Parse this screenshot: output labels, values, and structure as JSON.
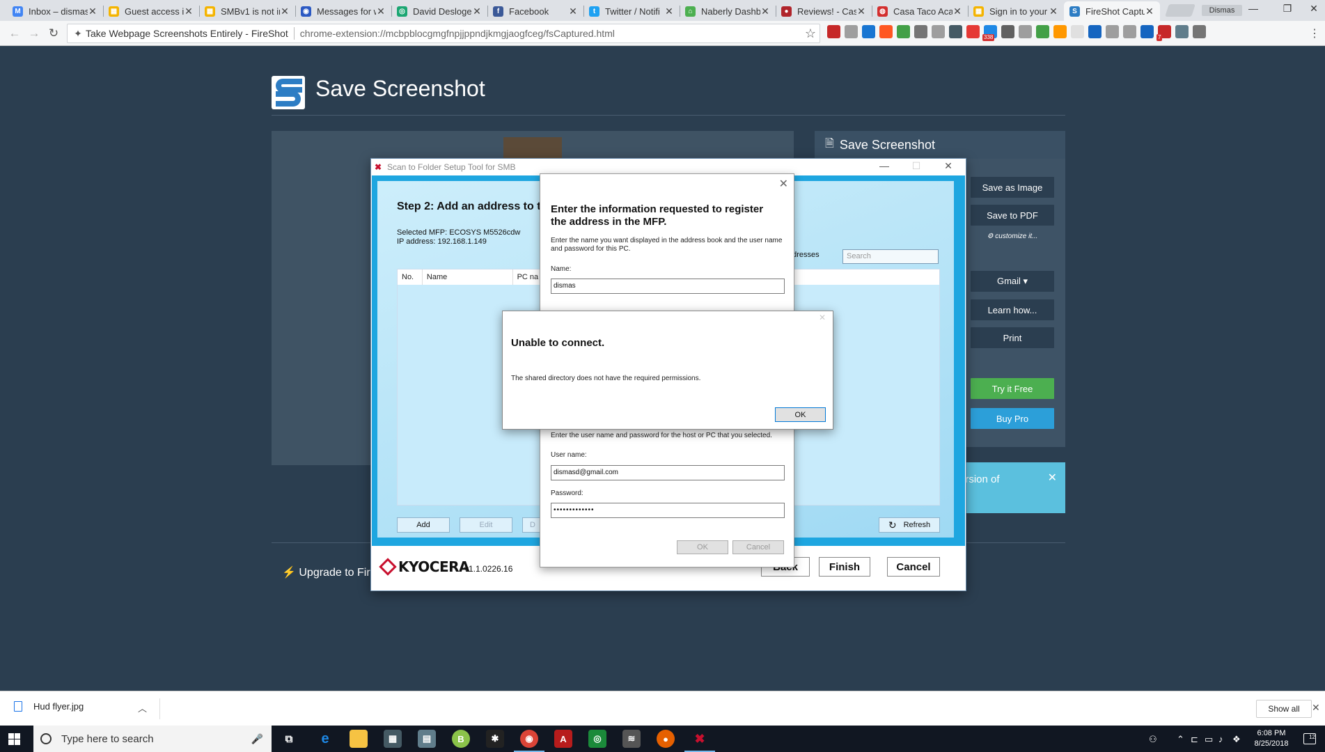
{
  "browser": {
    "tabs": [
      {
        "title": "Inbox – dismas",
        "color": "#4285f4",
        "icon": "M"
      },
      {
        "title": "Guest access in",
        "color": "#f4b400",
        "icon": "▦"
      },
      {
        "title": "SMBv1 is not in",
        "color": "#f4b400",
        "icon": "▦"
      },
      {
        "title": "Messages for w",
        "color": "#2b59c3",
        "icon": "◉"
      },
      {
        "title": "David Desloge",
        "color": "#1ba672",
        "icon": "◎"
      },
      {
        "title": "Facebook",
        "color": "#3b5998",
        "icon": "f"
      },
      {
        "title": "Twitter / Notifi",
        "color": "#1da1f2",
        "icon": "t"
      },
      {
        "title": "Naberly Dashb",
        "color": "#4caf50",
        "icon": "⌂"
      },
      {
        "title": "Reviews! - Casa",
        "color": "#b0242b",
        "icon": "●"
      },
      {
        "title": "Casa Taco Acad",
        "color": "#d32f2f",
        "icon": "◍"
      },
      {
        "title": "Sign in to your",
        "color": "#f4b400",
        "icon": "▦"
      },
      {
        "title": "FireShot Captu",
        "color": "#2d7dc4",
        "icon": "S",
        "active": true
      }
    ],
    "profile_name": "Dismas",
    "omnibox": {
      "extension_name": "Take Webpage Screenshots Entirely - FireShot",
      "url": "chrome-extension://mcbpblocgmgfnpjjppndjkmgjaogfceg/fsCaptured.html"
    },
    "extension_badges": [
      "338",
      "7"
    ],
    "extension_colors": [
      "#c62828",
      "#9e9e9e",
      "#1976d2",
      "#ff5722",
      "#43a047",
      "#757575",
      "#9e9e9e",
      "#455a64",
      "#e53935",
      "#1e88e5",
      "#616161",
      "#9e9e9e",
      "#43a047",
      "#ff9800",
      "#e0e0e0",
      "#1565c0",
      "#9e9e9e",
      "#9e9e9e",
      "#1565c0",
      "#c62828",
      "#607d8b",
      "#757575"
    ]
  },
  "fireshot": {
    "title": "Save Screenshot",
    "side_title": "Save Screenshot",
    "buttons": {
      "save_image": "Save as Image",
      "save_pdf": "Save to PDF",
      "customize": "⚙ customize it...",
      "gmail": "Gmail ▾",
      "learn": "Learn how...",
      "print": "Print",
      "try_free": "Try it Free",
      "buy_pro": "Buy Pro"
    },
    "banner_text": "ersion of",
    "upgrade_text": "Upgrade to FireS"
  },
  "kyocera": {
    "window_title": "Scan to Folder Setup Tool for SMB",
    "step_title": "Step 2: Add an address to th",
    "selected_mfp": "Selected MFP: ECOSYS M5526cdw",
    "ip_address": "IP address: 192.168.1.149",
    "addresses_label": "ddresses",
    "search_placeholder": "Search",
    "columns": [
      "No.",
      "Name",
      "PC na"
    ],
    "buttons": {
      "add": "Add",
      "edit": "Edit",
      "delete": "D",
      "refresh": "Refresh"
    },
    "brand": "KYOCERA",
    "version": "v1.1.0226.16",
    "footer_buttons": {
      "back": "Back",
      "finish": "Finish",
      "cancel": "Cancel"
    }
  },
  "register_dialog": {
    "heading": "Enter the information requested to register the address in the MFP.",
    "intro": "Enter the name you want displayed in the address book and the user name and password for this PC.",
    "name_label": "Name:",
    "name_value": "dismas",
    "cred_intro": "Enter the user name and password for the host or PC that you selected.",
    "username_label": "User name:",
    "username_value": "dismasd@gmail.com",
    "password_label": "Password:",
    "password_value": "•••••••••••••",
    "ok": "OK",
    "cancel": "Cancel"
  },
  "error_dialog": {
    "heading": "Unable to connect.",
    "message": "The shared directory does not have the required permissions.",
    "ok": "OK"
  },
  "downloads": {
    "file": "Hud flyer.jpg",
    "show_all": "Show all"
  },
  "taskbar": {
    "search_placeholder": "Type here to search",
    "time": "6:08 PM",
    "date": "8/25/2018",
    "notifications": "12"
  }
}
